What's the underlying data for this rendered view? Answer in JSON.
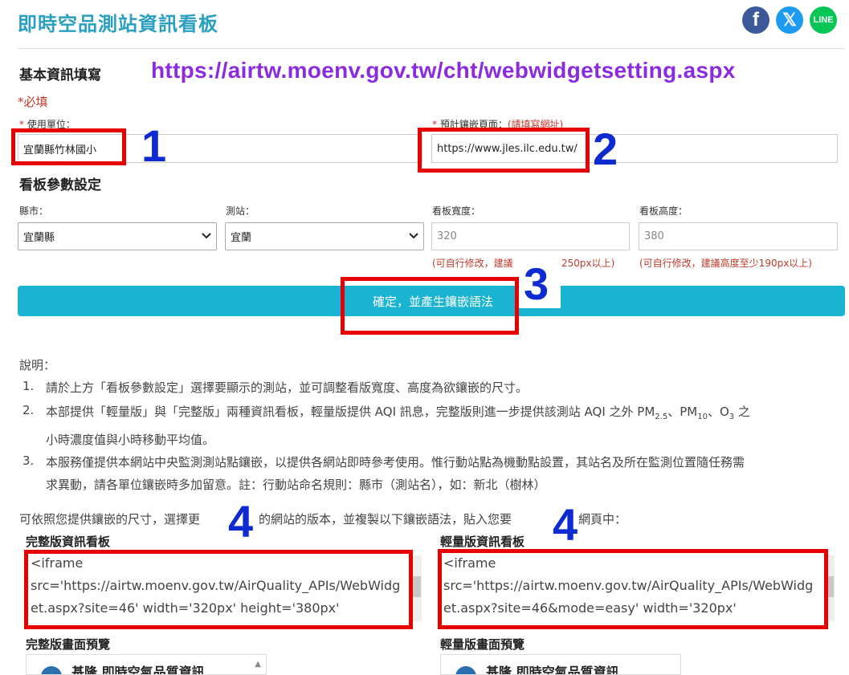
{
  "header": {
    "title": "即時空品測站資訊看板",
    "social": {
      "facebook": "f",
      "x": "𝕏",
      "line": "LINE"
    }
  },
  "annotation": {
    "url": "https://airtw.moenv.gov.tw/cht/webwidgetsetting.aspx",
    "step1": "1",
    "step2": "2",
    "step3": "3",
    "step4a": "4",
    "step4b": "4"
  },
  "basic": {
    "section_title": "基本資訊填寫",
    "required_note": "*必填",
    "unit_label": "使用單位：",
    "unit_value": "宜蘭縣竹林國小",
    "page_label": "預計鑲嵌頁面：",
    "page_label_hint": "(請填寫網址)",
    "page_value": "https://www.jles.ilc.edu.tw/"
  },
  "settings": {
    "section_title": "看板參數設定",
    "county_label": "縣市：",
    "county_value": "宜蘭縣",
    "station_label": "測站：",
    "station_value": "宜蘭",
    "width_label": "看板寬度：",
    "width_placeholder": "320",
    "width_hint": "(可自行修改，建議",
    "width_hint_end": "250px以上)",
    "height_label": "看板高度：",
    "height_placeholder": "380",
    "height_hint": "(可自行修改，建議高度至少190px以上)",
    "confirm_label": "確定，並產生鑲嵌語法"
  },
  "description": {
    "heading": "說明：",
    "items": [
      {
        "num": "1.",
        "text": "請於上方「看板參數設定」選擇要顯示的測站，並可調整看版寬度、高度為欲鑲嵌的尺寸。"
      },
      {
        "num": "2.",
        "text_a": "本部提供「輕量版」與「完整版」兩種資訊看板，輕量版提供 AQI 訊息，完整版則進一步提供該測站 AQI 之外 PM",
        "sub1": "2.5",
        "text_b": "、PM",
        "sub2": "10",
        "text_c": "、O",
        "sub3": "3",
        "text_d": " 之",
        "text_e": "小時濃度值與小時移動平均值。"
      },
      {
        "num": "3.",
        "text_a": "本服務僅提供本網站中央監測測站點鑲嵌，以提供各網站即時參考使用。惟行動站點為機動點設置，其站名及所在監測位置隨任務需",
        "text_b": "求異動，請各單位鑲嵌時多加留意。註：行動站命名規則：縣市（測站名），如：新北（樹林）"
      }
    ],
    "instruction_a": "可依照您提供鑲嵌的尺寸，選擇更",
    "instruction_b": "的網站的版本，並複製以下鑲嵌語法，貼入您要",
    "instruction_c": "網頁中："
  },
  "full": {
    "title": "完整版資訊看板",
    "code_lines": [
      "<iframe",
      "src='https://airtw.moenv.gov.tw/AirQuality_APIs/WebWidg",
      "et.aspx?site=46' width='320px' height='380px'"
    ],
    "preview_title": "完整版畫面預覽",
    "preview_text": "基隆 即時空氣品質資訊"
  },
  "easy": {
    "title": "輕量版資訊看板",
    "code_lines": [
      "<iframe",
      "src='https://airtw.moenv.gov.tw/AirQuality_APIs/WebWidg",
      "et.aspx?site=46&mode=easy' width='320px'"
    ],
    "preview_title": "輕量版畫面預覽",
    "preview_text": "基隆 即時空氣品質資訊"
  }
}
